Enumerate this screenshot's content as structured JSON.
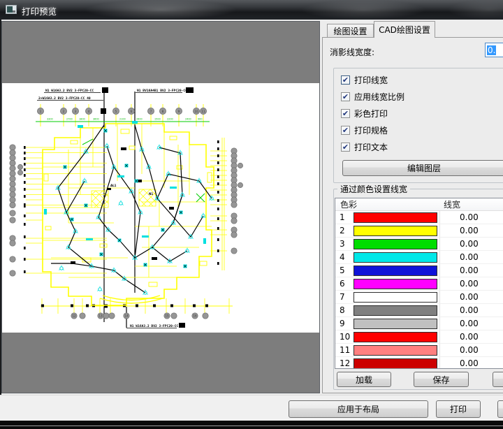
{
  "window": {
    "title": "打印预览"
  },
  "tabs": {
    "drawing_settings": "绘图设置",
    "cad_drawing_settings": "CAD绘图设置"
  },
  "panel": {
    "hatch_linewidth_label": "消影线宽度:",
    "hatch_linewidth_value": "0.",
    "checkboxes": [
      {
        "label": "打印线宽",
        "checked": true
      },
      {
        "label": "应用线宽比例",
        "checked": true
      },
      {
        "label": "彩色打印",
        "checked": true
      },
      {
        "label": "打印规格",
        "checked": true
      },
      {
        "label": "打印文本",
        "checked": true
      }
    ],
    "edit_layers_button": "编辑图层",
    "groupbox_title": "通过颜色设置线宽",
    "table": {
      "col_color": "色彩",
      "col_width": "线宽",
      "rows": [
        {
          "index": "1",
          "color": "#ff0000",
          "width": "0.00"
        },
        {
          "index": "2",
          "color": "#ffff00",
          "width": "0.00"
        },
        {
          "index": "3",
          "color": "#00dd00",
          "width": "0.00"
        },
        {
          "index": "4",
          "color": "#00e8e8",
          "width": "0.00"
        },
        {
          "index": "5",
          "color": "#0f13d8",
          "width": "0.00"
        },
        {
          "index": "6",
          "color": "#ff00ff",
          "width": "0.00"
        },
        {
          "index": "7",
          "color": "#ffffff",
          "width": "0.00"
        },
        {
          "index": "8",
          "color": "#808080",
          "width": "0.00"
        },
        {
          "index": "9",
          "color": "#c0c0c0",
          "width": "0.00"
        },
        {
          "index": "10",
          "color": "#ff0000",
          "width": "0.00"
        },
        {
          "index": "11",
          "color": "#ff8080",
          "width": "0.00"
        },
        {
          "index": "12",
          "color": "#cc0000",
          "width": "0.00"
        }
      ]
    },
    "load_button": "加载",
    "save_button": "保存"
  },
  "footer": {
    "apply_layout_button": "应用于布局",
    "print_button": "打印"
  },
  "drawing": {
    "annotations": {
      "top_left_line1": "N1 W16A3.2 BV2 3-FPC20-CC",
      "top_left_line2": "2×W16A3.2 BV2 3-FPC20-CC   40",
      "top_right": "N1 BV16A4B1 BV2 3-FPC20-CC",
      "bottom": "N1 W16A3.2 BV2 3-FPC20-CC"
    },
    "colors": {
      "walls": "#ffff00",
      "devices": "#00dcdc",
      "cables": "#000000",
      "dimensions": "#00cc00",
      "grid_bubbles": "#969696"
    }
  }
}
